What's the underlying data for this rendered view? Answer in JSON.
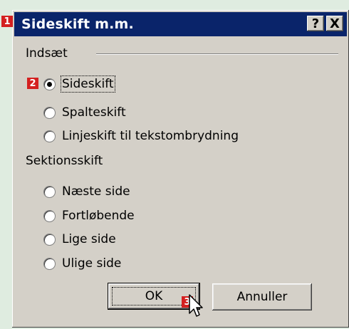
{
  "window": {
    "title": "Sideskift m.m.",
    "help_label": "?",
    "close_label": "X"
  },
  "insert_group": {
    "label": "Indsæt",
    "options": [
      {
        "label": "Sideskift",
        "checked": true
      },
      {
        "label": "Spalteskift",
        "checked": false
      },
      {
        "label": "Linjeskift til tekstombrydning",
        "checked": false
      }
    ]
  },
  "section_group": {
    "label": "Sektionsskift",
    "options": [
      {
        "label": "Næste side",
        "checked": false
      },
      {
        "label": "Fortløbende",
        "checked": false
      },
      {
        "label": "Lige side",
        "checked": false
      },
      {
        "label": "Ulige side",
        "checked": false
      }
    ]
  },
  "buttons": {
    "ok": "OK",
    "cancel": "Annuller"
  },
  "markers": [
    "1",
    "2",
    "3"
  ],
  "colors": {
    "titlebar": "#0a246a",
    "dialog": "#d4d0c8",
    "marker": "#d42020",
    "background": "#dfece0"
  }
}
